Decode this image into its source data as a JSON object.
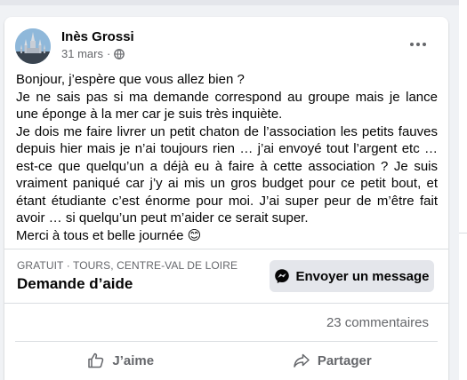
{
  "post": {
    "author": "Inès Grossi",
    "date": "31 mars",
    "separator": "·",
    "body": {
      "line1": "Bonjour, j’espère que vous allez bien ?",
      "para2": "Je ne sais pas si ma demande correspond au groupe mais je lance une éponge à la mer car je suis très inquiète.",
      "para3": "Je dois me faire livrer un petit chaton de l’association les petits fauves depuis hier mais je n’ai toujours rien … j’ai envoyé tout l’argent etc … est-ce que quelqu’un a déjà eu à faire à cette association ? Je suis vraiment paniqué car j’y ai mis un gros budget pour ce petit bout, et étant étudiante c’est énorme pour moi. J’ai super peur de m’être fait avoir … si quelqu’un peut m’aider ce serait super.",
      "closing": "Merci à tous et belle journée",
      "emoji": "😊"
    }
  },
  "listing": {
    "meta": "GRATUIT · TOURS, CENTRE-VAL DE LOIRE",
    "title": "Demande d’aide",
    "message_button": "Envoyer un message"
  },
  "stats": {
    "comments": "23 commentaires"
  },
  "actions": {
    "like": "J’aime",
    "share": "Partager"
  },
  "icons": {
    "privacy": "globe-icon",
    "more": "more-horizontal-icon",
    "messenger": "messenger-icon",
    "like": "thumbs-up-icon",
    "share": "share-arrow-icon"
  },
  "colors": {
    "secondary_text": "#65676b",
    "button_bg": "#e4e6eb",
    "page_bg": "#f0f2f5"
  }
}
